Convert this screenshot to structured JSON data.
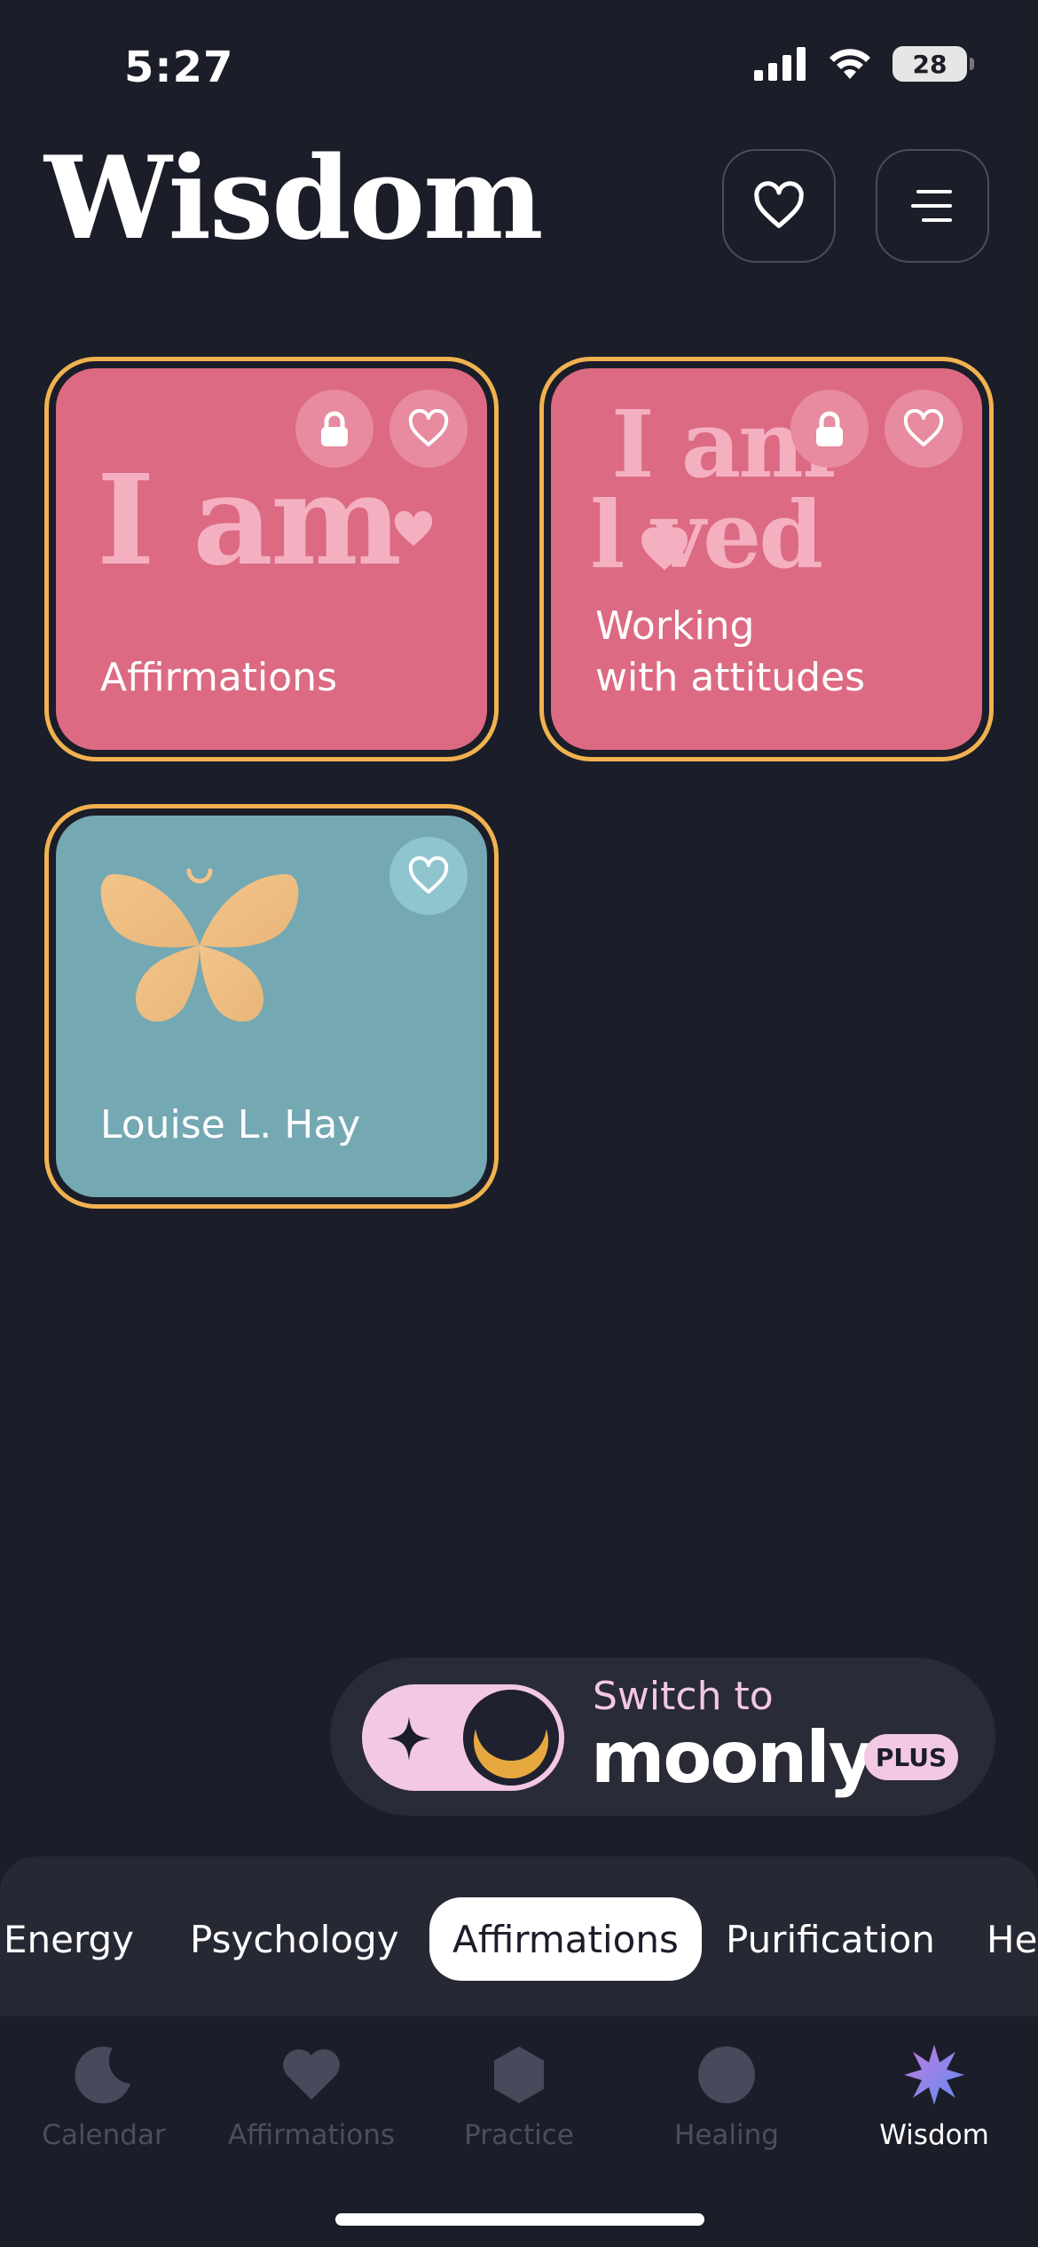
{
  "status": {
    "time": "5:27",
    "battery": "28"
  },
  "header": {
    "title": "Wisdom",
    "favorites_icon": "heart-outline-icon",
    "menu_icon": "menu-icon"
  },
  "cards": [
    {
      "label": "Affirmations",
      "art_text": "I am",
      "locked": true,
      "color": "#dc6a83"
    },
    {
      "label_line1": "Working",
      "label_line2": "with attitudes",
      "art_line1": "I am",
      "art_line2": "l ved",
      "locked": true,
      "color": "#dc6a83"
    },
    {
      "label": "Louise L. Hay",
      "locked": false,
      "color": "#74a8b3"
    }
  ],
  "banner": {
    "subtitle": "Switch to",
    "brand": "moonly",
    "badge": "PLUS"
  },
  "categories": {
    "items": [
      "Energy",
      "Psychology",
      "Affirmations",
      "Purification",
      "Hea"
    ],
    "selected": "Affirmations"
  },
  "tabs": [
    {
      "label": "Calendar",
      "icon": "moon-icon"
    },
    {
      "label": "Affirmations",
      "icon": "heart-icon"
    },
    {
      "label": "Practice",
      "icon": "hexagon-icon"
    },
    {
      "label": "Healing",
      "icon": "circle-icon"
    },
    {
      "label": "Wisdom",
      "icon": "star-icon"
    }
  ],
  "active_tab": "Wisdom",
  "colors": {
    "background": "#1b1d29",
    "card_border": "#f1b24f",
    "pink": "#dc6a83",
    "teal": "#74a8b3",
    "accent": "#f3c8e3"
  }
}
